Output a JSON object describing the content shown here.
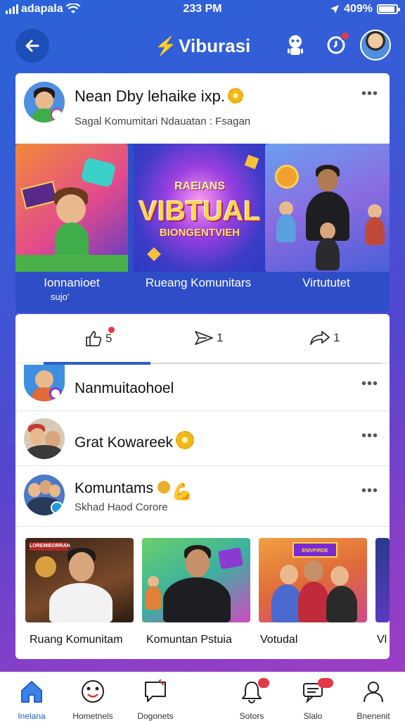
{
  "status_bar": {
    "carrier": "adapala",
    "time": "233 PM",
    "battery": "409%"
  },
  "header": {
    "app_title": "Viburasi"
  },
  "post": {
    "author": "Nean Dby lehaike ixp.",
    "subtitle": "Sagal Komumitari Ndauatan : Fsagan",
    "media": [
      {
        "caption": "Ionnanioet",
        "caption_sub": "sujo'"
      },
      {
        "caption": "Rueang Komunitars",
        "banner_top": "RAEIANS",
        "banner_main": "VIBTUAL",
        "banner_bottom": "BIONGENTVIEH"
      },
      {
        "caption": "Virtututet"
      }
    ]
  },
  "actions": {
    "like_count": "5",
    "send_count": "1",
    "share_count": "1"
  },
  "community_list": [
    {
      "name": "Nanmuitaohoel",
      "subtitle": ""
    },
    {
      "name": "Grat Kowareek",
      "subtitle": ""
    },
    {
      "name": "Komuntams",
      "subtitle": "Skhad Haod Corore"
    }
  ],
  "thumbnails": [
    {
      "caption": "Ruang Komunitam",
      "label": "LOREMIEORRAN"
    },
    {
      "caption": "Komuntan Pstuia",
      "label": ""
    },
    {
      "caption": "Votudal",
      "label": "ENIVFIRDE"
    },
    {
      "caption": "Vl",
      "label": ""
    }
  ],
  "bottom_nav": [
    {
      "label": "Inelana",
      "icon": "home-icon",
      "active": true
    },
    {
      "label": "Hometnels",
      "icon": "smiley-icon"
    },
    {
      "label": "Dogonets",
      "icon": "chat-icon"
    },
    {
      "label": "Sotors",
      "icon": "bell-icon"
    },
    {
      "label": "Slalo",
      "icon": "message-icon"
    },
    {
      "label": "Bnenenit",
      "icon": "profile-icon"
    }
  ],
  "colors": {
    "accent": "#1d5fd0",
    "badge": "#e53945",
    "gold": "#f1b91c"
  }
}
